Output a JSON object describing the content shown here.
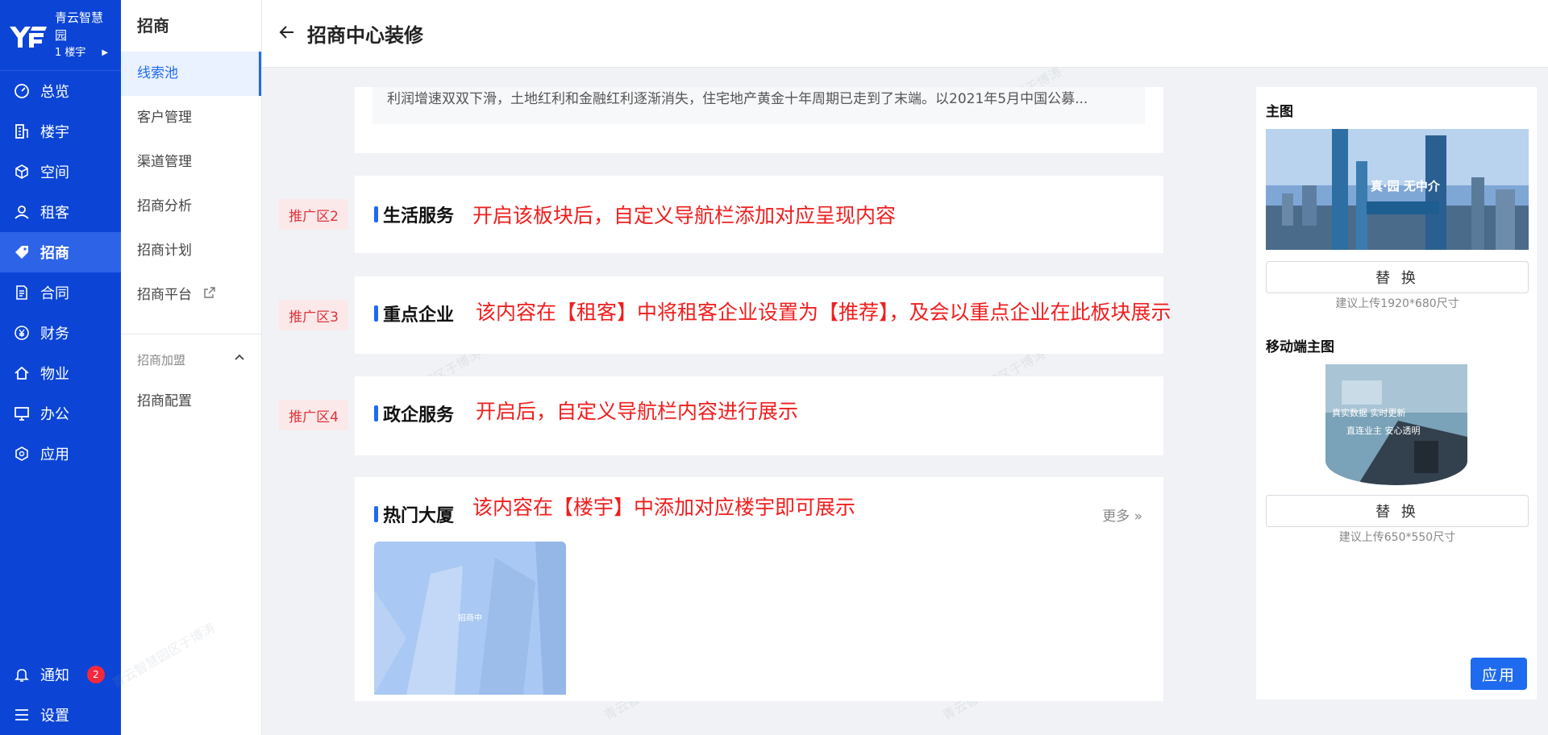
{
  "brand": {
    "name": "青云智慧园",
    "building": "1 楼宇"
  },
  "nav": {
    "items": [
      {
        "label": "总览",
        "icon": "dashboard-icon"
      },
      {
        "label": "楼宇",
        "icon": "building-icon"
      },
      {
        "label": "空间",
        "icon": "cube-icon"
      },
      {
        "label": "租客",
        "icon": "user-icon"
      },
      {
        "label": "招商",
        "icon": "tag-icon",
        "active": true
      },
      {
        "label": "合同",
        "icon": "document-icon"
      },
      {
        "label": "财务",
        "icon": "yen-icon"
      },
      {
        "label": "物业",
        "icon": "home-icon"
      },
      {
        "label": "办公",
        "icon": "monitor-icon"
      },
      {
        "label": "应用",
        "icon": "app-icon"
      }
    ],
    "notify_label": "通知",
    "notify_count": "2",
    "settings_label": "设置"
  },
  "subnav": {
    "title": "招商",
    "items": [
      "线索池",
      "客户管理",
      "渠道管理",
      "招商分析",
      "招商计划",
      "招商平台"
    ],
    "group_label": "招商加盟",
    "group_items": [
      "招商配置"
    ]
  },
  "header": {
    "title": "招商中心装修"
  },
  "summary_text": "利润增速双双下滑，土地红利和金融红利逐渐消失，住宅地产黄金十年周期已走到了末端。以2021年5月中国公募...",
  "sections": {
    "life": {
      "title": "生活服务",
      "tag": "推广区2",
      "note": "开启该板块后，自定义导航栏添加对应呈现内容"
    },
    "key": {
      "title": "重点企业",
      "tag": "推广区3",
      "note": "该内容在【租客】中将租客企业设置为【推荐】，及会以重点企业在此板块展示"
    },
    "gov": {
      "title": "政企服务",
      "tag": "推广区4",
      "note": "开启后，自定义导航栏内容进行展示"
    },
    "hot": {
      "title": "热门大厦",
      "note": "该内容在【楼宇】中添加对应楼宇即可展示",
      "more": "更多",
      "building_status": "招商中"
    }
  },
  "right_panel": {
    "main_image_title": "主图",
    "main_image_caption": "真·园 无中介",
    "replace_label": "替 换",
    "main_hint": "建议上传1920*680尺寸",
    "mobile_image_title": "移动端主图",
    "mobile_caption_line1": "真实数据 实时更新",
    "mobile_caption_line2": "直连业主 安心透明",
    "mobile_hint": "建议上传650*550尺寸",
    "apply_label": "应用"
  },
  "watermark": "青云智慧园区于博涛",
  "colors": {
    "nav_bg": "#0c45d6",
    "accent": "#1f6bf0",
    "note_red": "#f01e1e"
  }
}
